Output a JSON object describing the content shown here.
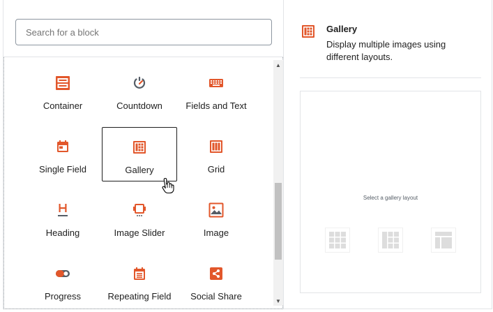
{
  "search": {
    "placeholder": "Search for a block"
  },
  "blocks": [
    {
      "label": "Container",
      "icon": "container-icon"
    },
    {
      "label": "Countdown",
      "icon": "countdown-icon"
    },
    {
      "label": "Fields and Text",
      "icon": "keyboard-icon"
    },
    {
      "label": "Single Field",
      "icon": "calendar-field-icon"
    },
    {
      "label": "Gallery",
      "icon": "gallery-icon",
      "selected": true
    },
    {
      "label": "Grid",
      "icon": "grid-icon"
    },
    {
      "label": "Heading",
      "icon": "heading-icon"
    },
    {
      "label": "Image Slider",
      "icon": "image-slider-icon"
    },
    {
      "label": "Image",
      "icon": "image-icon"
    },
    {
      "label": "Progress",
      "icon": "toggle-icon"
    },
    {
      "label": "Repeating Field",
      "icon": "calendar-list-icon"
    },
    {
      "label": "Social Share",
      "icon": "share-icon"
    }
  ],
  "preview": {
    "title": "Gallery",
    "description": "Display multiple images using different layouts.",
    "hint": "Select a gallery layout"
  },
  "colors": {
    "accent": "#e2572b",
    "selected_border": "#1e1e1e",
    "muted_icon": "#dddddd"
  }
}
